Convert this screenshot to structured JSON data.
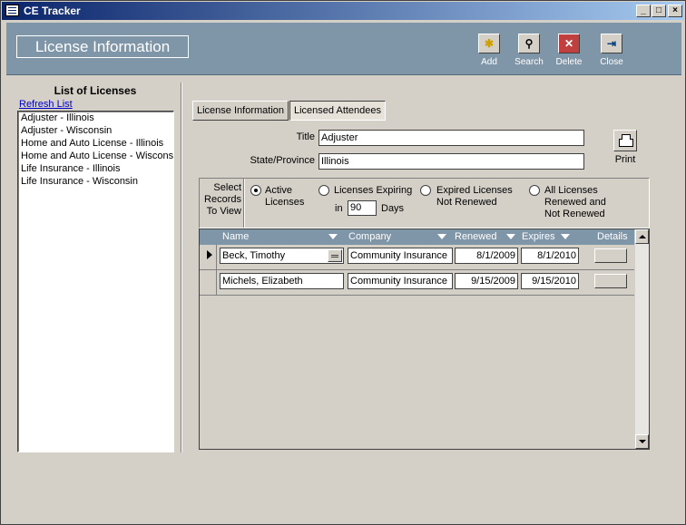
{
  "window": {
    "title": "CE Tracker",
    "controls": [
      "_",
      "□",
      "×"
    ]
  },
  "header": {
    "title": "License Information",
    "tools": [
      {
        "label": "Add",
        "icon": "add-record-icon"
      },
      {
        "label": "Search",
        "icon": "binoculars-icon"
      },
      {
        "label": "Delete",
        "icon": "delete-icon"
      },
      {
        "label": "Close",
        "icon": "exit-door-icon"
      }
    ]
  },
  "sidebar": {
    "title": "List of Licenses",
    "refresh_label": "Refresh List",
    "items": [
      "Adjuster - Illinois",
      "Adjuster - Wisconsin",
      "Home and Auto License - Illinois",
      "Home and Auto License - Wisconsin",
      "Life Insurance - Illinois",
      "Life Insurance - Wisconsin"
    ]
  },
  "tabs": [
    {
      "label": "License Information",
      "active": false
    },
    {
      "label": "Licensed Attendees",
      "active": true
    }
  ],
  "form": {
    "title_label": "Title",
    "title_value": "Adjuster",
    "state_label": "State/Province",
    "state_value": "Illinois",
    "print_label": "Print"
  },
  "filter": {
    "select_label_1": "Select",
    "select_label_2": "Records",
    "select_label_3": "To View",
    "opt_active_1": "Active",
    "opt_active_2": "Licenses",
    "opt_expiring_1": "Licenses Expiring",
    "opt_expiring_in": "in",
    "opt_expiring_days_value": "90",
    "opt_expiring_days": "Days",
    "opt_expired_1": "Expired Licenses",
    "opt_expired_2": "Not Renewed",
    "opt_all_1": "All Licenses",
    "opt_all_2": "Renewed and",
    "opt_all_3": "Not Renewed",
    "selected": "active"
  },
  "grid": {
    "columns": {
      "name": "Name",
      "company": "Company",
      "renewed": "Renewed",
      "expires": "Expires",
      "details": "Details"
    },
    "rows": [
      {
        "name": "Beck, Timothy",
        "company": "Community Insurance",
        "renewed": "8/1/2009",
        "expires": "8/1/2010"
      },
      {
        "name": "Michels, Elizabeth",
        "company": "Community Insurance",
        "renewed": "9/15/2009",
        "expires": "9/15/2010"
      }
    ]
  },
  "colors": {
    "header_bg": "#7f95a8",
    "window_bg": "#d4d0c8",
    "titlebar": "#0a246a"
  }
}
